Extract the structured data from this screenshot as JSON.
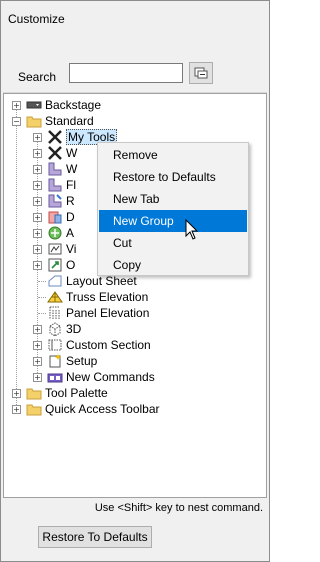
{
  "panel": {
    "title": "Customize"
  },
  "search": {
    "label": "Search",
    "value": "",
    "button_icon": "filter-icon"
  },
  "tree": {
    "items": [
      {
        "label": "Backstage"
      },
      {
        "label": "Standard"
      },
      {
        "label": "My Tools"
      },
      {
        "label": "W"
      },
      {
        "label": "W"
      },
      {
        "label": "Fl"
      },
      {
        "label": "R"
      },
      {
        "label": "D"
      },
      {
        "label": "A"
      },
      {
        "label": "Vi"
      },
      {
        "label": "O"
      },
      {
        "label": "Layout Sheet"
      },
      {
        "label": "Truss Elevation"
      },
      {
        "label": "Panel Elevation"
      },
      {
        "label": "3D"
      },
      {
        "label": "Custom Section"
      },
      {
        "label": "Setup"
      },
      {
        "label": "New Commands"
      },
      {
        "label": "Tool Palette"
      },
      {
        "label": "Quick Access Toolbar"
      }
    ]
  },
  "context_menu": {
    "items": [
      {
        "label": "Remove"
      },
      {
        "label": "Restore to Defaults"
      },
      {
        "label": "New Tab"
      },
      {
        "label": "New Group",
        "highlighted": true
      },
      {
        "label": "Cut"
      },
      {
        "label": "Copy"
      }
    ],
    "highlight_color": "#0078d7"
  },
  "footer": {
    "hint": "Use <Shift> key to nest command.",
    "restore_label": "Restore To Defaults"
  }
}
